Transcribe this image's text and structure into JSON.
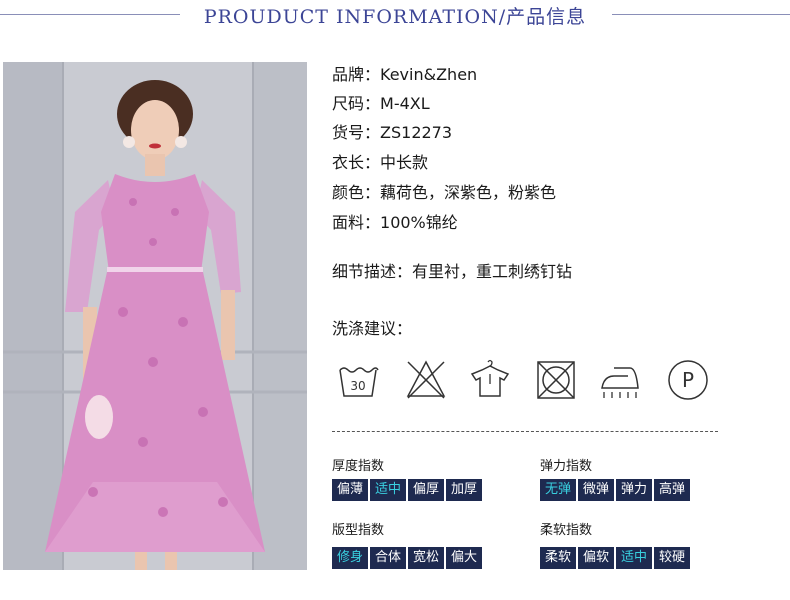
{
  "header": {
    "title": "PROUDUCT INFORMATION/产品信息"
  },
  "specs": [
    {
      "label": "品牌：",
      "value": "Kevin&Zhen"
    },
    {
      "label": "尺码：",
      "value": "M-4XL"
    },
    {
      "label": "货号：",
      "value": "ZS12273"
    },
    {
      "label": "衣长：",
      "value": "中长款"
    },
    {
      "label": "颜色：",
      "value": "藕荷色，深紫色，粉紫色"
    },
    {
      "label": "面料：",
      "value": "100%锦纶"
    }
  ],
  "detail": {
    "label": "细节描述：",
    "value": "有里衬，重工刺绣钉钻"
  },
  "washing": {
    "title": "洗涤建议：",
    "icons": [
      "wash-30-icon",
      "no-bleach-icon",
      "hang-dry-icon",
      "no-tumble-dry-icon",
      "iron-icon",
      "dry-clean-p-icon"
    ],
    "temp": "30",
    "dryclean_letter": "P"
  },
  "indices": {
    "thickness": {
      "title": "厚度指数",
      "options": [
        "偏薄",
        "适中",
        "偏厚",
        "加厚"
      ],
      "selected": 1
    },
    "elasticity": {
      "title": "弹力指数",
      "options": [
        "无弹",
        "微弹",
        "弹力",
        "高弹"
      ],
      "selected": 0
    },
    "fit": {
      "title": "版型指数",
      "options": [
        "修身",
        "合体",
        "宽松",
        "偏大"
      ],
      "selected": 0
    },
    "softness": {
      "title": "柔软指数",
      "options": [
        "柔软",
        "偏软",
        "适中",
        "较硬"
      ],
      "selected": 2
    }
  },
  "colors": {
    "accent": "#3c4596",
    "cell_bg": "#1e2a50",
    "cell_on": "#39d0e0",
    "dress": "#d98fc6"
  }
}
